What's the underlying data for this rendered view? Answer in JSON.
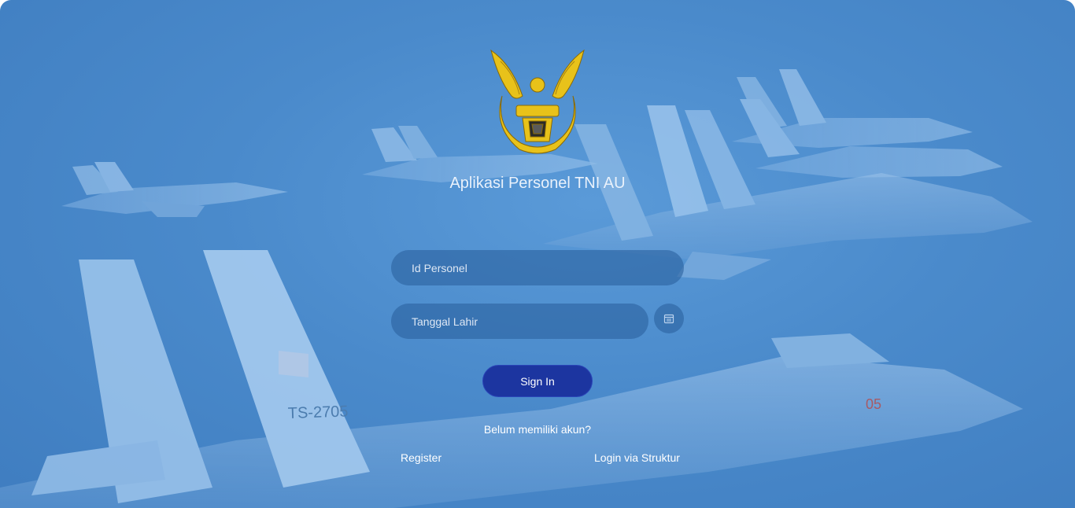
{
  "app": {
    "title": "Aplikasi Personel TNI AU",
    "logo_icon": "tni-au-emblem-icon"
  },
  "form": {
    "id_placeholder": "Id Personel",
    "date_placeholder": "Tanggal Lahir",
    "calendar_icon": "calendar-icon",
    "signin_label": "Sign In"
  },
  "footer": {
    "question": "Belum memiliki akun?",
    "register_label": "Register",
    "struktur_label": "Login via Struktur"
  },
  "colors": {
    "background": "#4a8acb",
    "field": "#2c62a0",
    "button": "#1c35a0",
    "emblem": "#e8c21a"
  }
}
